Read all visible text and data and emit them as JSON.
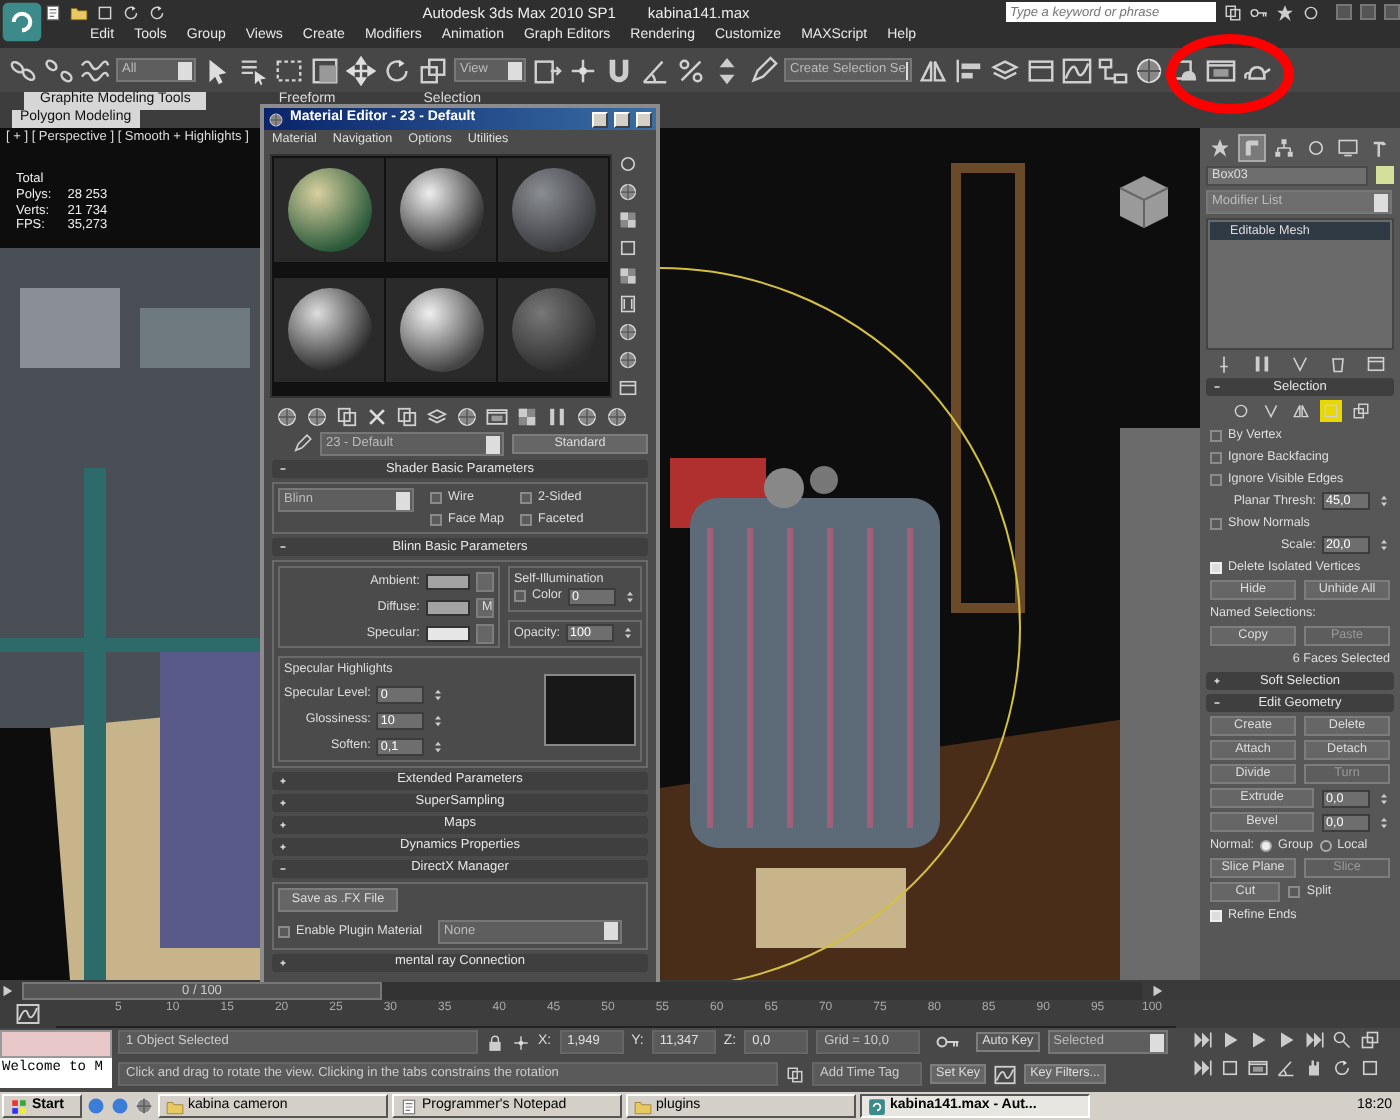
{
  "title_bar": {
    "title": "Autodesk 3ds Max  2010 SP1",
    "file": "kabina141.max",
    "search": {
      "placeholder": "Type a keyword or phrase"
    }
  },
  "menu": [
    "Edit",
    "Tools",
    "Group",
    "Views",
    "Create",
    "Modifiers",
    "Animation",
    "Graph Editors",
    "Rendering",
    "Customize",
    "MAXScript",
    "Help"
  ],
  "toolbar": {
    "selection_filter": "All",
    "reference_coordinate": "View",
    "named_selection": "Create Selection Se"
  },
  "ribbon": {
    "tabs": [
      {
        "label": "Graphite Modeling Tools",
        "selected": true
      },
      {
        "label": "Freeform",
        "selected": false
      },
      {
        "label": "Selection",
        "selected": false
      }
    ],
    "panel_title": "Polygon Modeling"
  },
  "viewport": {
    "label": "[ + ] [ Perspective ] [ Smooth + Highlights ]",
    "stats_title": "Total",
    "stats": [
      {
        "label": "Polys:",
        "value": "28 253"
      },
      {
        "label": "Verts:",
        "value": "21 734"
      },
      {
        "label": "FPS:",
        "value": "35,273"
      }
    ]
  },
  "material_editor": {
    "title": "Material Editor - 23 - Default",
    "menu": [
      "Material",
      "Navigation",
      "Options",
      "Utilities"
    ],
    "material_name": "23 - Default",
    "material_type": "Standard",
    "rollouts": [
      {
        "kind": "shader",
        "title": "Shader Basic Parameters",
        "expanded": true,
        "shader": "Blinn",
        "options": [
          {
            "label": "Wire",
            "checked": false
          },
          {
            "label": "2-Sided",
            "checked": false
          },
          {
            "label": "Face Map",
            "checked": false
          },
          {
            "label": "Faceted",
            "checked": false
          }
        ]
      },
      {
        "kind": "blinn",
        "title": "Blinn Basic Parameters",
        "expanded": true,
        "colors": [
          {
            "label": "Ambient:",
            "color": "#a3a3a3"
          },
          {
            "label": "Diffuse:",
            "color": "#a3a3a3"
          },
          {
            "label": "Specular:",
            "color": "#e6e6e6"
          }
        ],
        "map_button": "M",
        "self_illumination": {
          "title": "Self-Illumination",
          "label": "Color",
          "checked": false,
          "value": "0"
        },
        "opacity": {
          "label": "Opacity:",
          "value": "100"
        },
        "highlights": {
          "title": "Specular Highlights",
          "fields": [
            {
              "label": "Specular Level:",
              "value": "0"
            },
            {
              "label": "Glossiness:",
              "value": "10"
            },
            {
              "label": "Soften:",
              "value": "0,1"
            }
          ]
        }
      },
      {
        "title": "Extended Parameters",
        "expanded": false
      },
      {
        "title": "SuperSampling",
        "expanded": false
      },
      {
        "title": "Maps",
        "expanded": false
      },
      {
        "title": "Dynamics Properties",
        "expanded": false
      },
      {
        "kind": "directx",
        "title": "DirectX Manager",
        "expanded": true,
        "button": "Save as .FX File",
        "plugin": {
          "label": "Enable Plugin Material",
          "checked": false
        },
        "plugin_material": "None"
      },
      {
        "title": "mental ray Connection",
        "expanded": false
      }
    ]
  },
  "command_panel": {
    "tabs": [
      {
        "selected": false
      },
      {
        "selected": true
      },
      {
        "selected": false
      },
      {
        "selected": false
      },
      {
        "selected": false
      },
      {
        "selected": false
      }
    ],
    "object_name": "Box03",
    "modifier_list": "Modifier List",
    "stack": [
      {
        "label": "Editable Mesh",
        "selected": true
      }
    ],
    "rollouts": [
      {
        "title": "Selection",
        "expanded": true,
        "levels": [
          {
            "selected": false
          },
          {
            "selected": false
          },
          {
            "selected": false
          },
          {
            "selected": true
          },
          {
            "selected": false
          }
        ],
        "items": [
          {
            "kind": "checkbox",
            "label": "By Vertex",
            "checked": false
          },
          {
            "kind": "checkbox",
            "label": "Ignore Backfacing",
            "checked": false
          },
          {
            "kind": "checkbox",
            "label": "Ignore Visible Edges",
            "checked": false
          },
          {
            "kind": "spinner",
            "label": "Planar Thresh:",
            "value": "45,0"
          },
          {
            "kind": "checkbox",
            "label": "Show Normals",
            "checked": false
          },
          {
            "kind": "spinner",
            "label": "Scale:",
            "value": "20,0"
          },
          {
            "kind": "checkbox",
            "label": "Delete Isolated Vertices",
            "checked": true
          },
          {
            "kind": "buttons",
            "buttons": [
              {
                "label": "Hide",
                "disabled": false
              },
              {
                "label": "Unhide All",
                "disabled": false
              }
            ]
          },
          {
            "kind": "label",
            "text": "Named Selections:"
          },
          {
            "kind": "buttons",
            "buttons": [
              {
                "label": "Copy",
                "disabled": false
              },
              {
                "label": "Paste",
                "disabled": true
              }
            ]
          },
          {
            "kind": "info",
            "text": "6 Faces Selected"
          }
        ]
      },
      {
        "title": "Soft Selection",
        "expanded": false
      },
      {
        "title": "Edit Geometry",
        "expanded": true,
        "items": [
          {
            "kind": "buttons",
            "buttons": [
              {
                "label": "Create",
                "disabled": false
              },
              {
                "label": "Delete",
                "disabled": false
              }
            ]
          },
          {
            "kind": "buttons",
            "buttons": [
              {
                "label": "Attach",
                "disabled": false
              },
              {
                "label": "Detach",
                "disabled": false
              }
            ]
          },
          {
            "kind": "buttons",
            "buttons": [
              {
                "label": "Divide",
                "disabled": false
              },
              {
                "label": "Turn",
                "disabled": true
              }
            ]
          },
          {
            "kind": "button_spinner",
            "label": "Extrude",
            "value": "0,0"
          },
          {
            "kind": "button_spinner",
            "label": "Bevel",
            "value": "0,0"
          },
          {
            "kind": "radio",
            "label": "Normal:",
            "options": [
              {
                "label": "Group",
                "selected": true
              },
              {
                "label": "Local",
                "selected": false
              }
            ]
          },
          {
            "kind": "buttons",
            "buttons": [
              {
                "label": "Slice Plane",
                "disabled": false
              },
              {
                "label": "Slice",
                "disabled": true
              }
            ]
          },
          {
            "kind": "button_checkbox",
            "button": "Cut",
            "label": "Split",
            "checked": false
          },
          {
            "kind": "checkbox",
            "label": "Refine Ends",
            "checked": true
          }
        ]
      }
    ]
  },
  "time_slider": {
    "label": "0 / 100",
    "level": 0
  },
  "track_bar": {
    "ticks": [
      "5",
      "10",
      "15",
      "20",
      "25",
      "30",
      "35",
      "40",
      "45",
      "50",
      "55",
      "60",
      "65",
      "70",
      "75",
      "80",
      "85",
      "90",
      "95",
      "100"
    ]
  },
  "status": {
    "listener_output": "Welcome to M",
    "selection_info": "1 Object Selected",
    "prompt": "Click and drag to rotate the view.  Clicking in the tabs constrains the rotation",
    "coords": [
      {
        "axis": "X:",
        "value": "1,949"
      },
      {
        "axis": "Y:",
        "value": "11,347"
      },
      {
        "axis": "Z:",
        "value": "0,0"
      }
    ],
    "grid": "Grid = 10,0",
    "time_tag": "Add Time Tag",
    "auto_key": {
      "label": "Auto Key",
      "on": false
    },
    "key_mode": "Selected",
    "set_key": "Set Key",
    "key_filters": "Key Filters..."
  },
  "taskbar": {
    "start": "Start",
    "items": [
      {
        "label": "kabina cameron",
        "selected": false
      },
      {
        "label": "Programmer's Notepad",
        "selected": false
      },
      {
        "label": "plugins",
        "selected": false
      },
      {
        "label": "kabina141.max - Aut...",
        "selected": true
      }
    ],
    "clock": "18:20"
  }
}
